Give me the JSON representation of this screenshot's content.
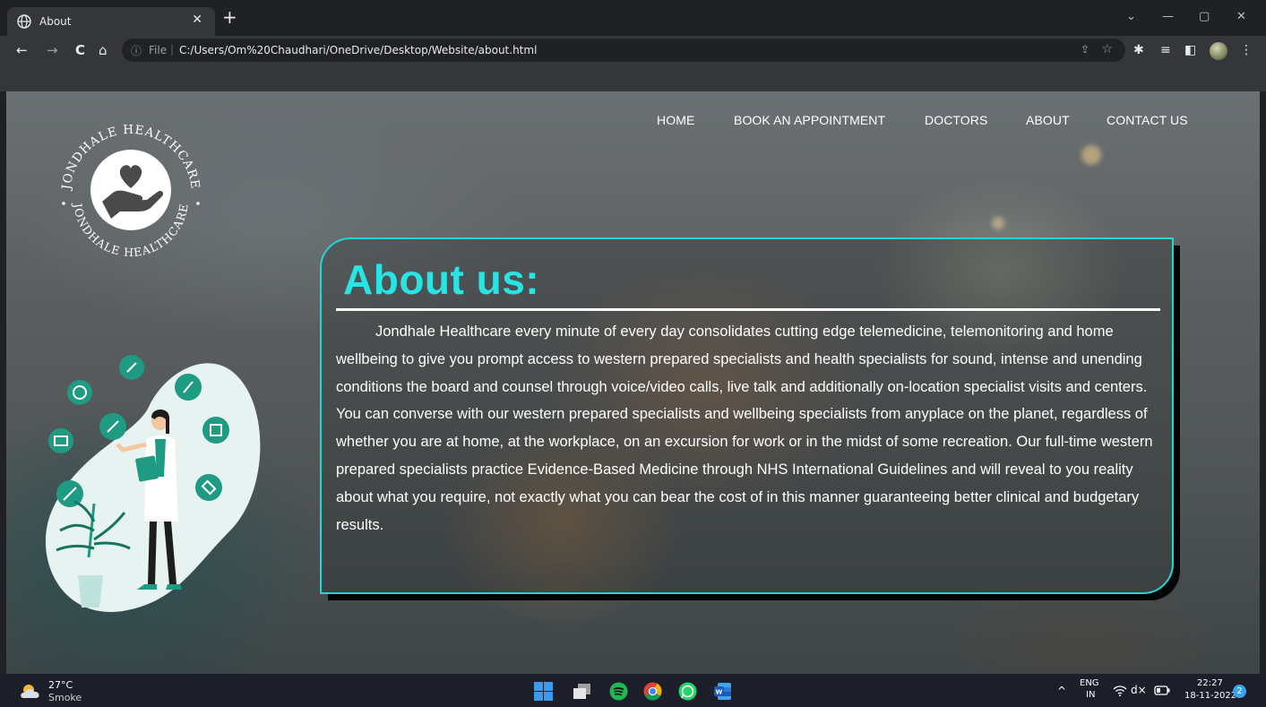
{
  "browser": {
    "tab_title": "About",
    "tab_close": "✕",
    "new_tab": "+",
    "window_controls": {
      "dropdown": "⌄",
      "minimize": "—",
      "restore": "▢",
      "close": "✕"
    },
    "nav_buttons": {
      "back": "←",
      "forward": "→",
      "reload": "C",
      "home": "⌂"
    },
    "address": {
      "info_icon": "ⓘ",
      "scheme_label": "File",
      "separator": "|",
      "url": "C:/Users/Om%20Chaudhari/OneDrive/Desktop/Website/about.html"
    },
    "toolbar_icons": {
      "share": "⇪",
      "star": "☆",
      "extensions": "✱",
      "reading_list": "≡",
      "side_panel": "◧",
      "menu": "⋮"
    }
  },
  "site": {
    "logo": {
      "top_text": "JONDHALE HEALTHCARE",
      "bottom_text": "JONDHALE HEALTHCARE"
    },
    "nav": [
      {
        "label": "HOME"
      },
      {
        "label": "BOOK AN APPOINTMENT"
      },
      {
        "label": "DOCTORS"
      },
      {
        "label": "ABOUT"
      },
      {
        "label": "CONTACT US"
      }
    ],
    "about": {
      "title": "About us:",
      "body": "Jondhale Healthcare every minute of every day consolidates cutting edge telemedicine, telemonitoring and home wellbeing to give you prompt access to western prepared specialists and health specialists for sound, intense and unending conditions the board and counsel through voice/video calls, live talk and additionally on-location specialist visits and centers. You can converse with our western prepared specialists and wellbeing specialists from anyplace on the planet, regardless of whether you are at home, at the workplace, on an excursion for work or in the midst of some recreation. Our full-time western prepared specialists practice Evidence-Based Medicine through NHS International Guidelines and will reveal to you reality about what you require, not exactly what you can bear the cost of in this manner guaranteeing better clinical and budgetary results."
    },
    "colors": {
      "accent": "#27e5e5",
      "illustration_teal": "#1f9a83",
      "illustration_blob": "#e7f3f1"
    }
  },
  "taskbar": {
    "weather": {
      "temp": "27°C",
      "desc": "Smoke"
    },
    "apps": [
      "windows-start",
      "task-view",
      "spotify",
      "chrome",
      "whatsapp",
      "word"
    ],
    "tray": {
      "chevron": "^",
      "lang_line1": "ENG",
      "lang_line2": "IN",
      "wifi": "wifi",
      "volume": "d×",
      "battery": "battery",
      "time": "22:27",
      "date": "18-11-2022",
      "notifications": "2"
    }
  }
}
